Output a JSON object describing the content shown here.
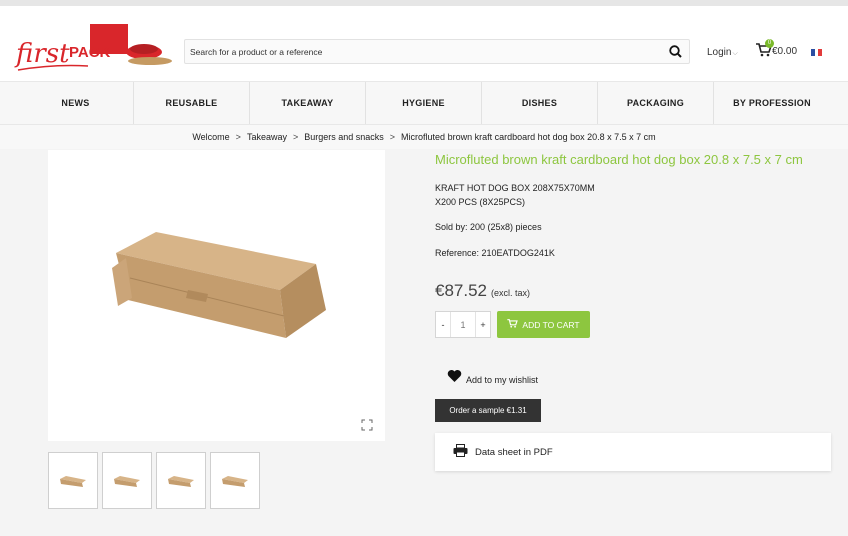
{
  "header": {
    "logo_text": "firstPACK",
    "search_placeholder": "Search for a product or a reference",
    "login_label": "Login",
    "cart_count": "0",
    "cart_amount": "€0.00"
  },
  "nav": {
    "items": [
      "NEWS",
      "REUSABLE",
      "TAKEAWAY",
      "HYGIENE",
      "DISHES",
      "PACKAGING",
      "BY PROFESSION"
    ]
  },
  "breadcrumb": {
    "items": [
      "Welcome",
      "Takeaway",
      "Burgers and snacks",
      "Microfluted brown kraft cardboard hot dog box 20.8 x 7.5 x 7 cm"
    ],
    "separator": ">"
  },
  "product": {
    "title": "Microfluted brown kraft cardboard hot dog box 20.8 x 7.5 x 7 cm",
    "desc_line1": "KRAFT HOT DOG BOX 208X75X70MM",
    "desc_line2": "X200 PCS (8X25PCS)",
    "sold_by": "Sold by: 200 (25x8) pieces",
    "reference": "Reference: 210EATDOG241K",
    "price": "€87.52",
    "price_note": "(excl. tax)",
    "qty_minus": "-",
    "quantity": "1",
    "qty_plus": "+",
    "add_to_cart": "ADD TO CART",
    "wishlist": "Add to my wishlist",
    "sample": "Order a sample €1.31",
    "datasheet": "Data sheet in PDF"
  },
  "colors": {
    "accent_green": "#8dc63f",
    "brand_red": "#d9262b",
    "dark_button": "#333333"
  },
  "icons": [
    "search-icon",
    "chevron-down-icon",
    "cart-icon",
    "flag-fr-icon",
    "expand-icon",
    "heart-icon",
    "printer-icon"
  ]
}
